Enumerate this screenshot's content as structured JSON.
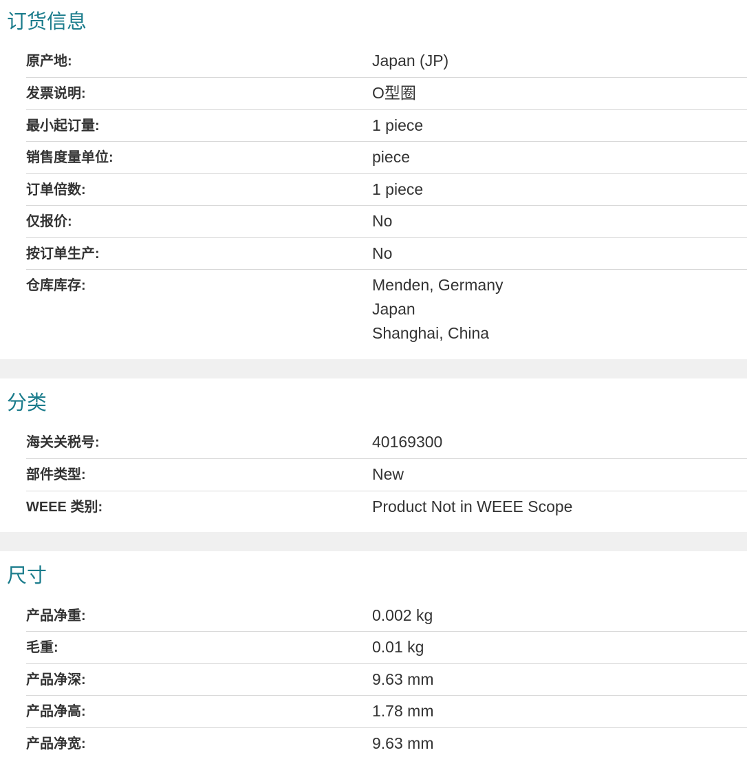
{
  "ordering": {
    "title": "订货信息",
    "rows": [
      {
        "label": "原产地:",
        "values": [
          "Japan (JP)"
        ]
      },
      {
        "label": "发票说明:",
        "values": [
          "O型圈"
        ]
      },
      {
        "label": "最小起订量:",
        "values": [
          "1 piece"
        ]
      },
      {
        "label": "销售度量单位:",
        "values": [
          "piece"
        ]
      },
      {
        "label": "订单倍数:",
        "values": [
          "1 piece"
        ]
      },
      {
        "label": "仅报价:",
        "values": [
          "No"
        ]
      },
      {
        "label": "按订单生产:",
        "values": [
          "No"
        ]
      },
      {
        "label": "仓库库存:",
        "values": [
          "Menden, Germany",
          "Japan",
          "Shanghai, China"
        ]
      }
    ]
  },
  "classification": {
    "title": "分类",
    "rows": [
      {
        "label": "海关关税号:",
        "values": [
          "40169300"
        ]
      },
      {
        "label": "部件类型:",
        "values": [
          "New"
        ]
      },
      {
        "label": "WEEE 类别:",
        "values": [
          "Product Not in WEEE Scope"
        ]
      }
    ]
  },
  "dimensions": {
    "title": "尺寸",
    "rows": [
      {
        "label": "产品净重:",
        "values": [
          "0.002 kg"
        ]
      },
      {
        "label": "毛重:",
        "values": [
          "0.01 kg"
        ]
      },
      {
        "label": "产品净深:",
        "values": [
          "9.63 mm"
        ]
      },
      {
        "label": "产品净高:",
        "values": [
          "1.78 mm"
        ]
      },
      {
        "label": "产品净宽:",
        "values": [
          "9.63 mm"
        ]
      }
    ]
  },
  "colors": {
    "title": "#1b7c8c",
    "text": "#333333",
    "divider": "#d8d8d8",
    "gap": "#f0f0f0"
  }
}
